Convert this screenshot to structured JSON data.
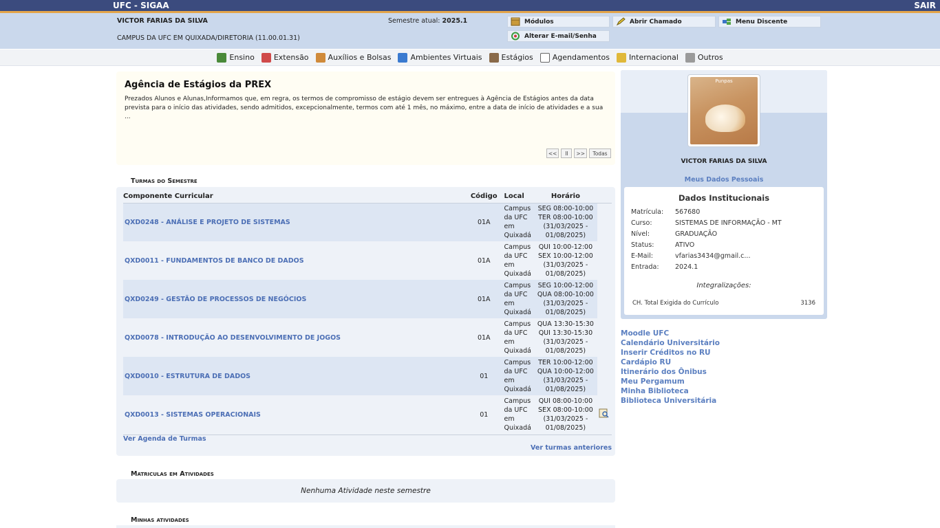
{
  "app": {
    "title": "UFC - SIGAA",
    "logout": "SAIR"
  },
  "header": {
    "user_name": "VICTOR FARIAS DA SILVA",
    "campus": "CAMPUS DA UFC EM QUIXADA/DIRETORIA (11.00.01.31)",
    "semester_label": "Semestre atual:",
    "semester_value": "2025.1",
    "buttons": {
      "modulos": "Módulos",
      "abrir_chamado": "Abrir Chamado",
      "menu_discente": "Menu Discente",
      "alterar_email": "Alterar E-mail/Senha"
    }
  },
  "menu": [
    "Ensino",
    "Extensão",
    "Auxílios e Bolsas",
    "Ambientes Virtuais",
    "Estágios",
    "Agendamentos",
    "Internacional",
    "Outros"
  ],
  "news": {
    "title": "Agência de Estágios da PREX",
    "text": "Prezados Alunos e Alunas,Informamos que, em regra, os termos de compromisso de estágio devem ser entregues à Agência de Estágios antes da data prevista para o início das atividades, sendo admitidos, excepcionalmente, termos com até 1 mês, no máximo, entre a data de início de atividades e a sua ...",
    "controls": {
      "prev": "<<",
      "pause": "II",
      "next": ">>",
      "all": "Todas"
    }
  },
  "turmas": {
    "section_title": "Turmas do Semestre",
    "headers": {
      "componente": "Componente Curricular",
      "codigo": "Código",
      "local": "Local",
      "horario": "Horário"
    },
    "rows": [
      {
        "componente": "QXD0248 - ANÁLISE E PROJETO DE SISTEMAS",
        "codigo": "01A",
        "local": "Campus da UFC em Quixadá",
        "horario": "SEG 08:00-10:00 TER 08:00-10:00 (31/03/2025 - 01/08/2025)"
      },
      {
        "componente": "QXD0011 - FUNDAMENTOS DE BANCO DE DADOS",
        "codigo": "01A",
        "local": "Campus da UFC em Quixadá",
        "horario": "QUI 10:00-12:00 SEX 10:00-12:00 (31/03/2025 - 01/08/2025)"
      },
      {
        "componente": "QXD0249 - GESTÃO DE PROCESSOS DE NEGÓCIOS",
        "codigo": "01A",
        "local": "Campus da UFC em Quixadá",
        "horario": "SEG 10:00-12:00 QUA 08:00-10:00 (31/03/2025 - 01/08/2025)"
      },
      {
        "componente": "QXD0078 - INTRODUÇÃO AO DESENVOLVIMENTO DE JOGOS",
        "codigo": "01A",
        "local": "Campus da UFC em Quixadá",
        "horario": "QUA 13:30-15:30 QUI 13:30-15:30 (31/03/2025 - 01/08/2025)"
      },
      {
        "componente": "QXD0010 - ESTRUTURA DE DADOS",
        "codigo": "01",
        "local": "Campus da UFC em Quixadá",
        "horario": "TER 10:00-12:00 QUA 10:00-12:00 (31/03/2025 - 01/08/2025)"
      },
      {
        "componente": "QXD0013 - SISTEMAS OPERACIONAIS",
        "codigo": "01",
        "local": "Campus da UFC em Quixadá",
        "horario": "QUI 08:00-10:00 SEX 08:00-10:00 (31/03/2025 - 01/08/2025)"
      }
    ],
    "agenda_link": "Ver Agenda de Turmas",
    "previous_link": "Ver turmas anteriores"
  },
  "atividades": {
    "section_title": "Matriculas em Atividades",
    "empty": "Nenhuma Atividade neste semestre"
  },
  "minhas": {
    "section_title": "Minhas atividades"
  },
  "profile": {
    "photo_caption": "Punpas",
    "name": "VICTOR FARIAS DA SILVA",
    "my_data": "Meus Dados Pessoais",
    "inst_title": "Dados Institucionais",
    "fields": [
      {
        "label": "Matrícula:",
        "value": "567680"
      },
      {
        "label": "Curso:",
        "value": "SISTEMAS DE INFORMAÇÃO - MT"
      },
      {
        "label": "Nível:",
        "value": "GRADUAÇÃO"
      },
      {
        "label": "Status:",
        "value": "ATIVO"
      },
      {
        "label": "E-Mail:",
        "value": "vfarias3434@gmail.c..."
      },
      {
        "label": "Entrada:",
        "value": "2024.1"
      }
    ],
    "integ_label": "Integralizações:",
    "ch_label": "CH. Total Exigida do Currículo",
    "ch_value": "3136"
  },
  "side_links": [
    "Moodle UFC",
    "Calendário Universitário",
    "Inserir Créditos no RU",
    "Cardápio RU",
    "Itinerário dos Ônibus",
    "Meu Pergamum",
    "Minha Biblioteca",
    "Biblioteca Universitária"
  ],
  "colors": {
    "topbar": "#3b4b7e",
    "accent": "#e4a54a",
    "header": "#cad8ec",
    "link": "#4c6fb5"
  }
}
